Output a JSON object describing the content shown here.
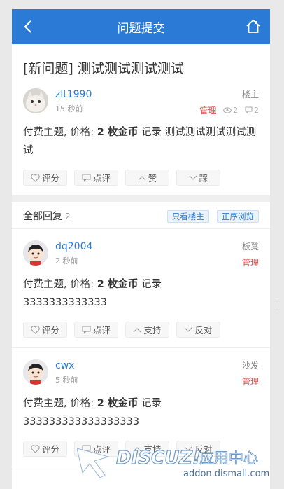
{
  "header": {
    "title": "问题提交"
  },
  "thread": {
    "title": "[新问题] 测试测试测试测试",
    "author": "zlt1990",
    "time": "15 秒前",
    "role": "楼主",
    "manage": "管理",
    "views": "2",
    "replies": "2",
    "content_prefix": "付费主题, 价格: ",
    "price": "2 枚金币",
    "content_suffix": " 记录 测试测试测试测试测试",
    "actions": {
      "rate": "评分",
      "comment": "点评",
      "like": "赞",
      "dislike": "踩"
    }
  },
  "reply_section": {
    "label": "全部回复",
    "count": "2",
    "filter_op": "只看楼主",
    "order": "正序浏览"
  },
  "replies": [
    {
      "author": "dq2004",
      "time": "2 秒前",
      "role": "板凳",
      "manage": "管理",
      "content_prefix": "付费主题, 价格: ",
      "price": "2 枚金币",
      "content_suffix": " 记录",
      "body": "3333333333333",
      "actions": {
        "rate": "评分",
        "comment": "点评",
        "support": "支持",
        "oppose": "反对"
      }
    },
    {
      "author": "cwx",
      "time": "5 秒前",
      "role": "沙发",
      "manage": "管理",
      "content_prefix": "付费主题, 价格: ",
      "price": "2 枚金币",
      "content_suffix": " 记录",
      "body": "333333333333333333",
      "actions": {
        "rate": "评分",
        "comment": "点评",
        "support": "支持",
        "oppose": "反对"
      }
    }
  ],
  "watermark": {
    "brand": "DISCUZ!",
    "suffix": "应用中心",
    "url": "addon.dismall.com"
  },
  "colors": {
    "accent": "#2b7bd6",
    "manage": "#d9534f",
    "bg": "#e9e9e9"
  }
}
